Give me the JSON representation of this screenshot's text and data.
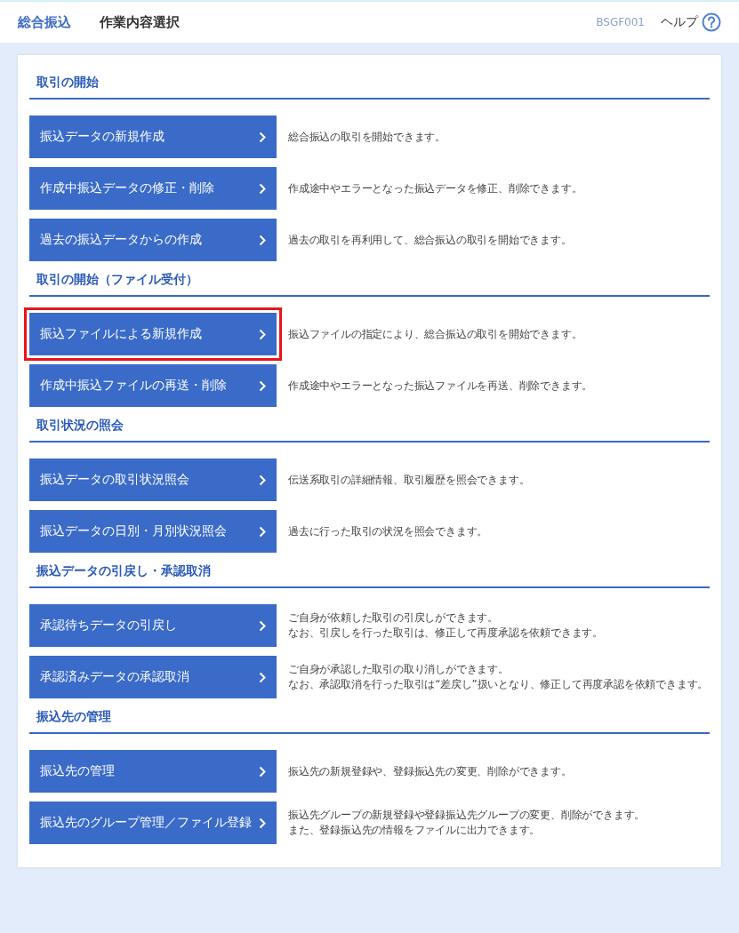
{
  "header": {
    "app_title": "総合振込",
    "page_title": "作業内容選択",
    "screen_id": "BSGF001",
    "help": "ヘルプ"
  },
  "sections": [
    {
      "title": "取引の開始",
      "items": [
        {
          "label": "振込データの新規作成",
          "highlighted": false,
          "description": [
            "総合振込の取引を開始できます。"
          ]
        },
        {
          "label": "作成中振込データの修正・削除",
          "highlighted": false,
          "description": [
            "作成途中やエラーとなった振込データを修正、削除できます。"
          ]
        },
        {
          "label": "過去の振込データからの作成",
          "highlighted": false,
          "description": [
            "過去の取引を再利用して、総合振込の取引を開始できます。"
          ]
        }
      ]
    },
    {
      "title": "取引の開始（ファイル受付）",
      "items": [
        {
          "label": "振込ファイルによる新規作成",
          "highlighted": true,
          "description": [
            "振込ファイルの指定により、総合振込の取引を開始できます。"
          ]
        },
        {
          "label": "作成中振込ファイルの再送・削除",
          "highlighted": false,
          "description": [
            "作成途中やエラーとなった振込ファイルを再送、削除できます。"
          ]
        }
      ]
    },
    {
      "title": "取引状況の照会",
      "items": [
        {
          "label": "振込データの取引状況照会",
          "highlighted": false,
          "description": [
            "伝送系取引の詳細情報、取引履歴を照会できます。"
          ]
        },
        {
          "label": "振込データの日別・月別状況照会",
          "highlighted": false,
          "description": [
            "過去に行った取引の状況を照会できます。"
          ]
        }
      ]
    },
    {
      "title": "振込データの引戻し・承認取消",
      "items": [
        {
          "label": "承認待ちデータの引戻し",
          "highlighted": false,
          "description": [
            "ご自身が依頼した取引の引戻しができます。",
            "なお、引戻しを行った取引は、修正して再度承認を依頼できます。"
          ]
        },
        {
          "label": "承認済みデータの承認取消",
          "highlighted": false,
          "description": [
            "ご自身が承認した取引の取り消しができます。",
            "なお、承認取消を行った取引は“差戻し”扱いとなり、修正して再度承認を依頼できます。"
          ]
        }
      ]
    },
    {
      "title": "振込先の管理",
      "items": [
        {
          "label": "振込先の管理",
          "highlighted": false,
          "description": [
            "振込先の新規登録や、登録振込先の変更、削除ができます。"
          ]
        },
        {
          "label": "振込先のグループ管理／ファイル登録",
          "highlighted": false,
          "description": [
            "振込先グループの新規登録や登録振込先グループの変更、削除ができます。",
            "また、登録振込先の情報をファイルに出力できます。"
          ]
        }
      ]
    }
  ]
}
